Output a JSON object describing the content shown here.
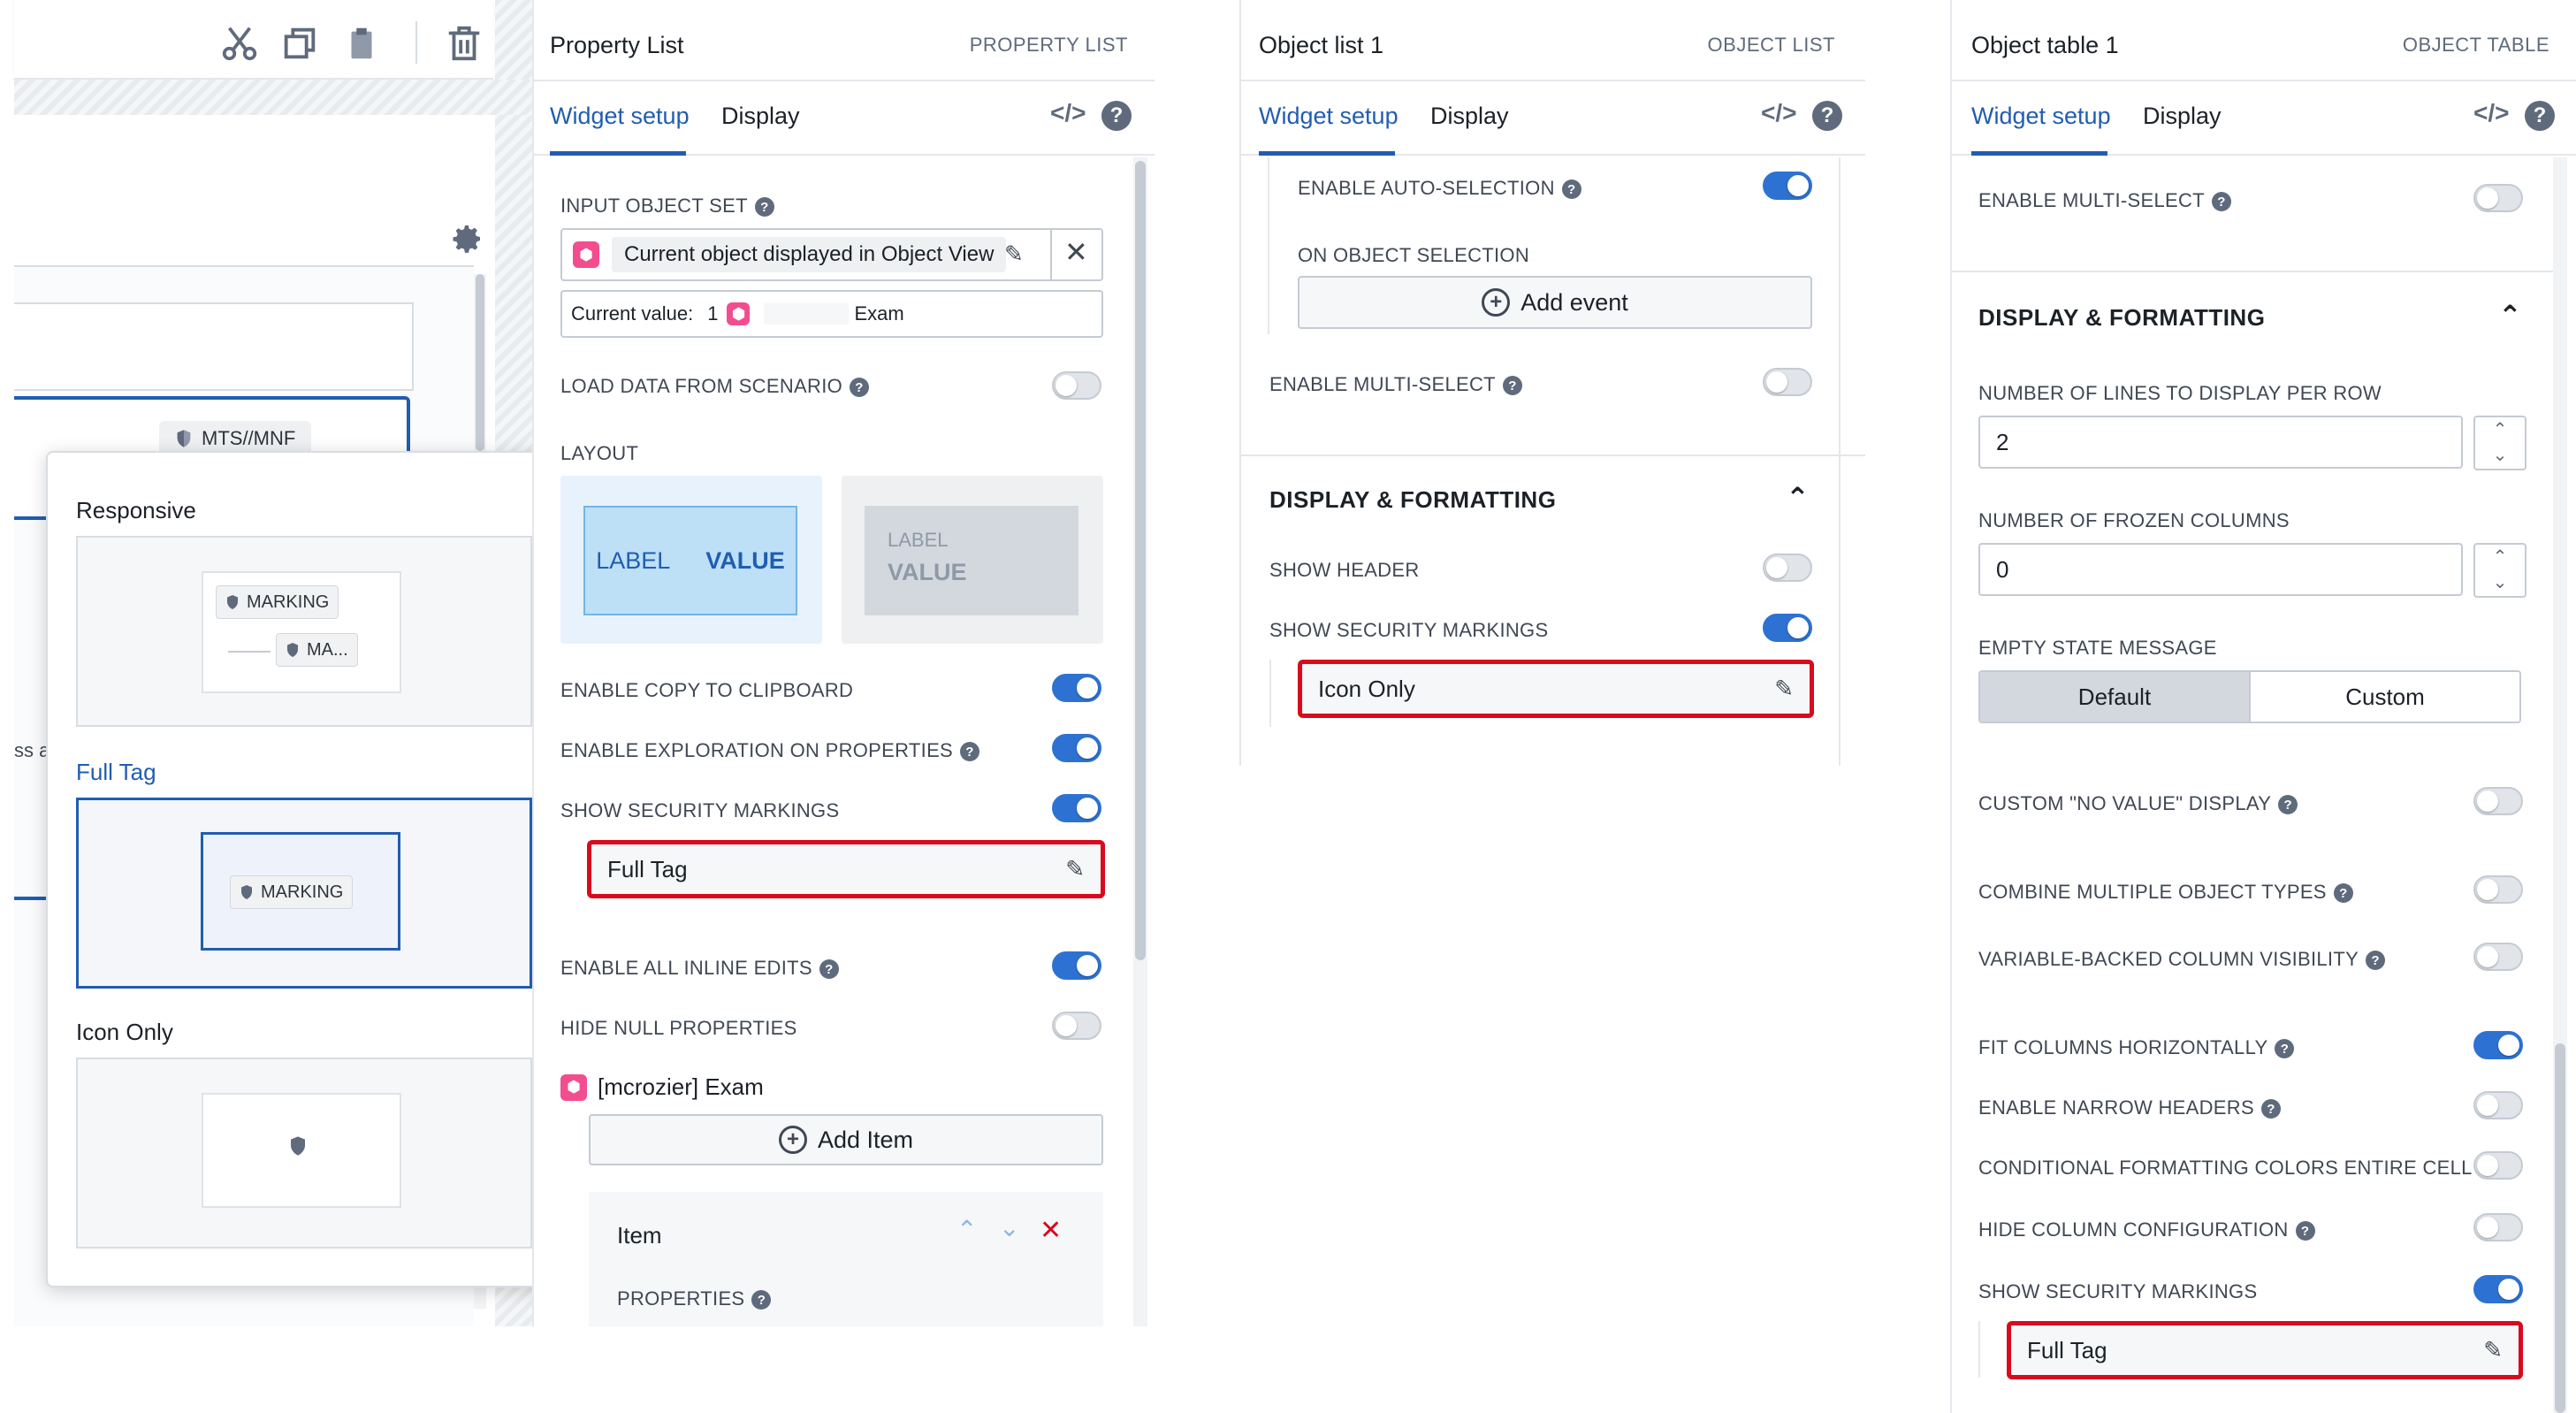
{
  "left": {
    "mts_tag": "MTS//MNF",
    "popover": {
      "options": [
        {
          "label": "Responsive",
          "preview_tag": "MARKING",
          "preview_tag2": "MA..."
        },
        {
          "label": "Full Tag",
          "preview_tag": "MARKING"
        },
        {
          "label": "Icon Only"
        }
      ]
    },
    "edge_text_1": "ss a"
  },
  "property_list": {
    "title": "Property List",
    "type": "PROPERTY LIST",
    "tabs": [
      "Widget setup",
      "Display"
    ],
    "input_object_set_label": "INPUT OBJECT SET",
    "input_object_set_value": "Current object displayed in Object View",
    "current_value_label": "Current value:",
    "current_value_count": "1",
    "current_value_name": "Exam",
    "load_from_scenario": "LOAD DATA FROM SCENARIO",
    "layout_label": "LAYOUT",
    "layout_inline_label": "LABEL",
    "layout_inline_value": "VALUE",
    "layout_stacked_label": "LABEL",
    "layout_stacked_value": "VALUE",
    "copy_clipboard": "ENABLE COPY TO CLIPBOARD",
    "exploration": "ENABLE EXPLORATION ON PROPERTIES",
    "security_markings": "SHOW SECURITY MARKINGS",
    "security_value": "Full Tag",
    "inline_edits": "ENABLE ALL INLINE EDITS",
    "hide_null": "HIDE NULL PROPERTIES",
    "object_type": "[mcrozier] Exam",
    "add_item": "Add Item",
    "item_label": "Item",
    "properties_label": "PROPERTIES"
  },
  "object_list": {
    "title": "Object list 1",
    "type": "OBJECT LIST",
    "tabs": [
      "Widget setup",
      "Display"
    ],
    "auto_selection": "ENABLE AUTO-SELECTION",
    "on_selection": "ON OBJECT SELECTION",
    "add_event": "Add event",
    "multi_select": "ENABLE MULTI-SELECT",
    "display_formatting": "DISPLAY & FORMATTING",
    "show_header": "SHOW HEADER",
    "security_markings": "SHOW SECURITY MARKINGS",
    "security_value": "Icon Only"
  },
  "object_table": {
    "title": "Object table 1",
    "type": "OBJECT TABLE",
    "tabs": [
      "Widget setup",
      "Display"
    ],
    "multi_select": "ENABLE MULTI-SELECT",
    "display_formatting": "DISPLAY & FORMATTING",
    "lines_per_row_label": "NUMBER OF LINES TO DISPLAY PER ROW",
    "lines_per_row_value": "2",
    "frozen_columns_label": "NUMBER OF FROZEN COLUMNS",
    "frozen_columns_value": "0",
    "empty_state_label": "EMPTY STATE MESSAGE",
    "empty_state_options": [
      "Default",
      "Custom"
    ],
    "no_value_display": "CUSTOM \"NO VALUE\" DISPLAY",
    "combine_types": "COMBINE MULTIPLE OBJECT TYPES",
    "variable_visibility": "VARIABLE-BACKED COLUMN VISIBILITY",
    "fit_columns": "FIT COLUMNS HORIZONTALLY",
    "narrow_headers": "ENABLE NARROW HEADERS",
    "conditional_formatting": "CONDITIONAL FORMATTING COLORS ENTIRE CELL",
    "hide_column_config": "HIDE COLUMN CONFIGURATION",
    "security_markings": "SHOW SECURITY MARKINGS",
    "security_value": "Full Tag"
  },
  "colors": {
    "accent": "#215db0",
    "toggle_on": "#2d72d2",
    "highlight": "#d9091e",
    "object_icon": "#f24d8f"
  }
}
